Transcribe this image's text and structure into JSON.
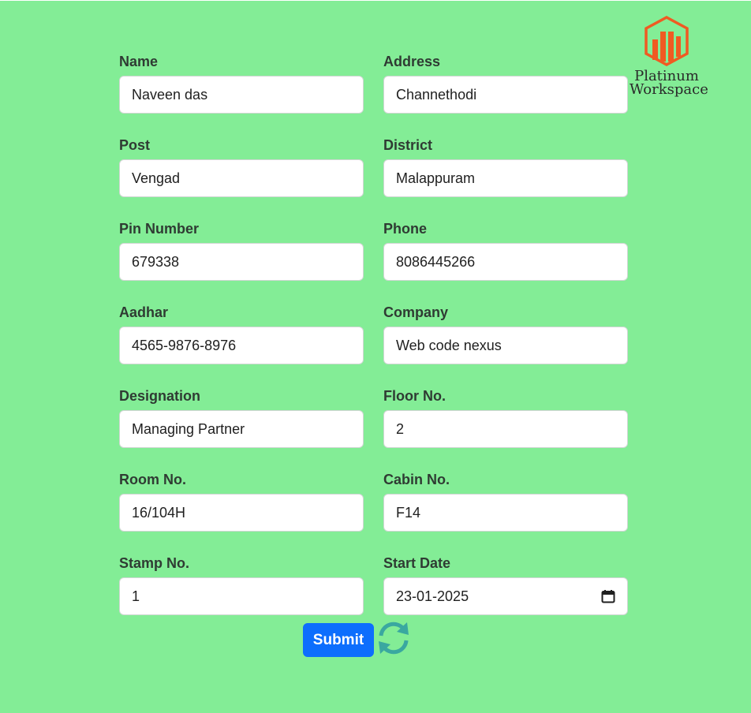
{
  "logo": {
    "line1": "Platinum",
    "line2": "Workspace",
    "brand_color": "#f05a22"
  },
  "form": {
    "rows": [
      [
        {
          "id": "name",
          "label": "Name",
          "value": "Naveen das"
        },
        {
          "id": "address",
          "label": "Address",
          "value": "Channethodi"
        }
      ],
      [
        {
          "id": "post",
          "label": "Post",
          "value": "Vengad"
        },
        {
          "id": "district",
          "label": "District",
          "value": "Malappuram"
        }
      ],
      [
        {
          "id": "pin-number",
          "label": "Pin Number",
          "value": "679338"
        },
        {
          "id": "phone",
          "label": "Phone",
          "value": "8086445266"
        }
      ],
      [
        {
          "id": "aadhar",
          "label": "Aadhar",
          "value": "4565-9876-8976"
        },
        {
          "id": "company",
          "label": "Company",
          "value": "Web code nexus"
        }
      ],
      [
        {
          "id": "designation",
          "label": "Designation",
          "value": "Managing Partner"
        },
        {
          "id": "floor-no",
          "label": "Floor No.",
          "value": "2"
        }
      ],
      [
        {
          "id": "room-no",
          "label": "Room No.",
          "value": "16/104H"
        },
        {
          "id": "cabin-no",
          "label": "Cabin No.",
          "value": "F14"
        }
      ],
      [
        {
          "id": "stamp-no",
          "label": "Stamp No.",
          "value": "1"
        },
        {
          "id": "start-date",
          "label": "Start Date",
          "value": "23-01-2025",
          "icon": "calendar-icon"
        }
      ]
    ]
  },
  "actions": {
    "submit_label": "Submit",
    "refresh_icon": "refresh-icon",
    "submit_color": "#0d6efd",
    "refresh_color": "#3aa8a0"
  },
  "theme": {
    "background": "#83ed96"
  }
}
